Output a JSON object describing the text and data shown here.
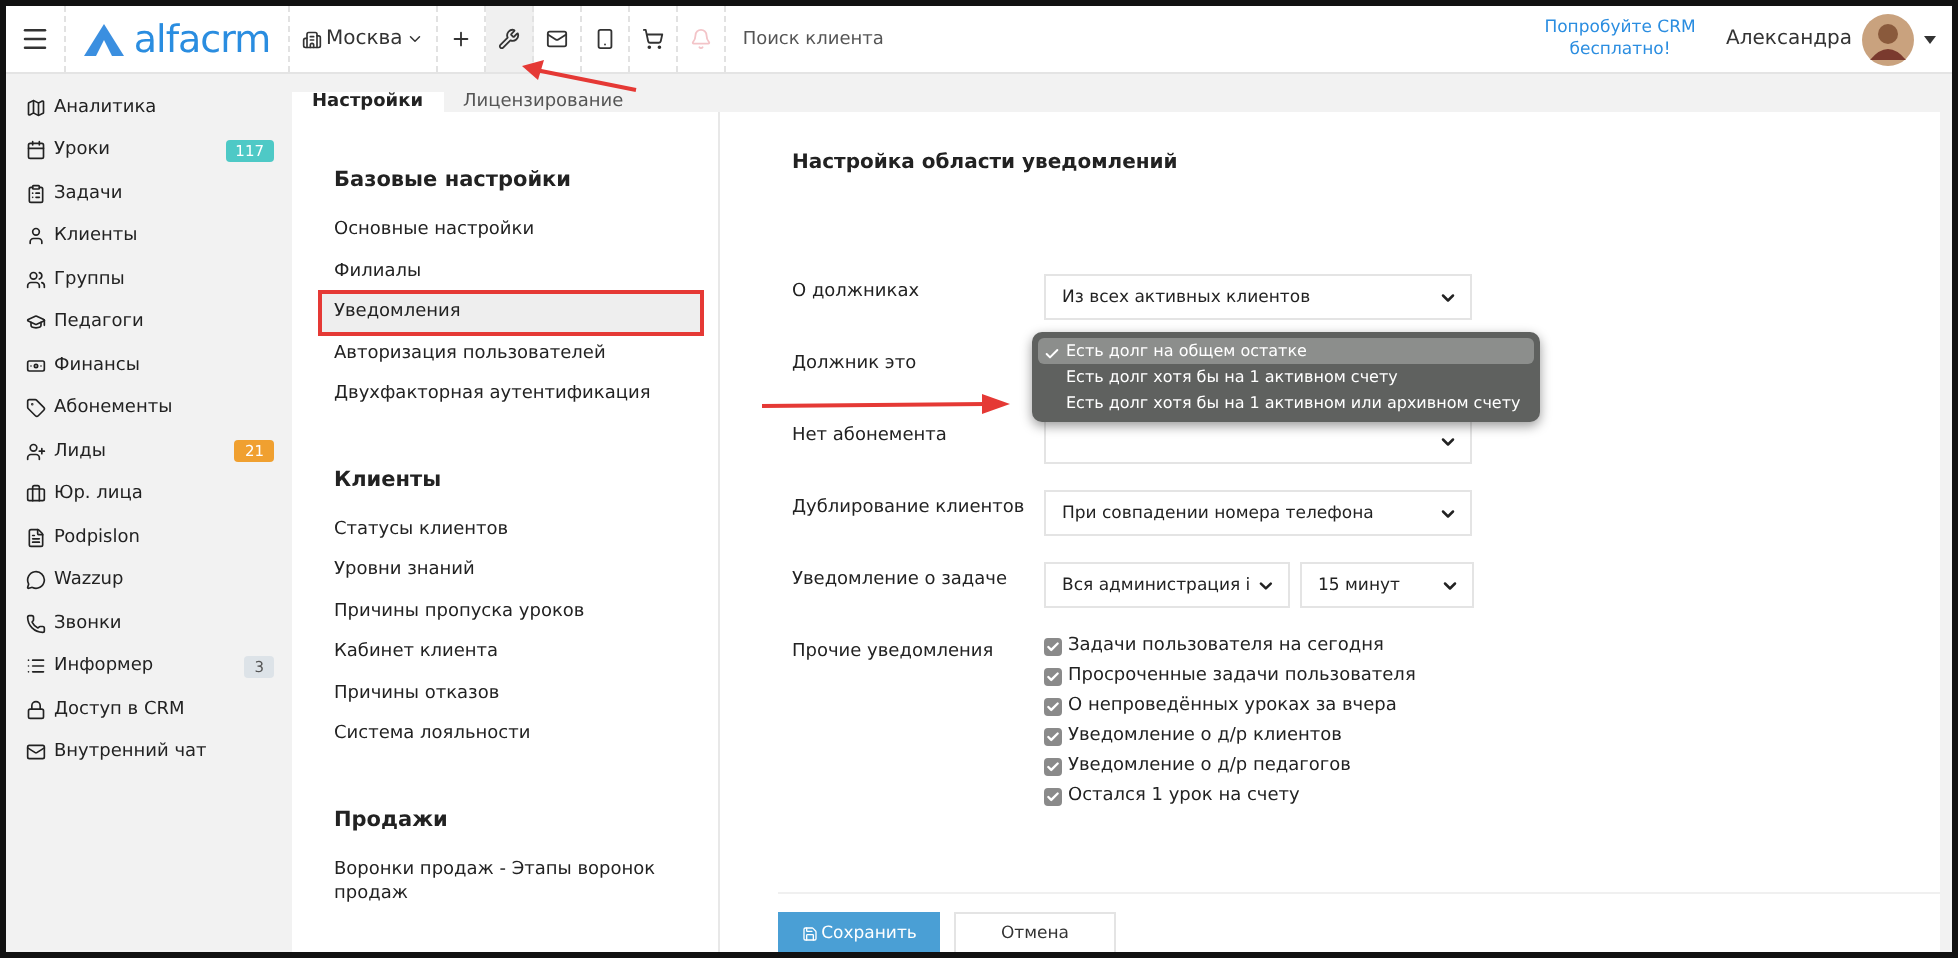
{
  "topbar": {
    "logo": "alfacrm",
    "branch": "Москва",
    "tools": [
      {
        "kind": "plus",
        "selected": false,
        "disabled": false
      },
      {
        "kind": "wrench",
        "selected": true,
        "disabled": false
      },
      {
        "kind": "mail",
        "selected": false,
        "disabled": false
      },
      {
        "kind": "phone",
        "selected": false,
        "disabled": false
      },
      {
        "kind": "cart",
        "selected": false,
        "disabled": false
      },
      {
        "kind": "bell",
        "selected": false,
        "disabled": true
      }
    ],
    "search": {
      "placeholder": "Поиск клиента"
    },
    "promo": "Попробуйте CRM бесплатно!",
    "user": "Александра"
  },
  "sidebar": {
    "items": [
      {
        "label": "Аналитика"
      },
      {
        "label": "Уроки",
        "badge": "117",
        "color": "#4ec9c6"
      },
      {
        "label": "Задачи"
      },
      {
        "label": "Клиенты"
      },
      {
        "label": "Группы"
      },
      {
        "label": "Педагоги"
      },
      {
        "label": "Финансы"
      },
      {
        "label": "Абонементы"
      },
      {
        "label": "Лиды",
        "badge": "21",
        "color": "#f0a030"
      },
      {
        "label": "Юр. лица"
      },
      {
        "label": "Podpislon"
      },
      {
        "label": "Wazzup"
      },
      {
        "label": "Звонки"
      },
      {
        "label": "Информер",
        "badge": "3",
        "color": "#dde3e8"
      },
      {
        "label": "Доступ в CRM"
      },
      {
        "label": "Внутренний чат"
      }
    ]
  },
  "tabs": [
    {
      "label": "Настройки",
      "selected": true
    },
    {
      "label": "Лицензирование",
      "selected": false
    }
  ],
  "settings_nav": [
    {
      "title": "Базовые настройки",
      "items": [
        {
          "label": "Основные настройки",
          "selected": false
        },
        {
          "label": "Филиалы",
          "selected": false
        },
        {
          "label": "Уведомления",
          "selected": true
        },
        {
          "label": "Авторизация пользователей",
          "selected": false
        },
        {
          "label": "Двухфакторная аутентификация",
          "selected": false
        }
      ]
    },
    {
      "title": "Клиенты",
      "items": [
        {
          "label": "Статусы клиентов",
          "selected": false
        },
        {
          "label": "Уровни знаний",
          "selected": false
        },
        {
          "label": "Причины пропуска уроков",
          "selected": false
        },
        {
          "label": "Кабинет клиента",
          "selected": false
        },
        {
          "label": "Причины отказов",
          "selected": false
        },
        {
          "label": "Система лояльности",
          "selected": false
        }
      ]
    },
    {
      "title": "Продажи",
      "items": [
        {
          "label": "Воронки продаж - Этапы воронок продаж",
          "selected": false
        }
      ]
    }
  ],
  "form": {
    "title": "Настройка области уведомлений",
    "rows": [
      {
        "kind": "select",
        "label": "О должниках",
        "values": [
          "Из всех активных клиентов"
        ]
      },
      {
        "kind": "dropdown",
        "label": "Должник это",
        "options": [
          {
            "label": "Есть долг на общем остатке",
            "selected": true
          },
          {
            "label": "Есть долг хотя бы на 1 активном счету",
            "selected": false
          },
          {
            "label": "Есть долг хотя бы на 1 активном или архивном счету",
            "selected": false
          }
        ]
      },
      {
        "kind": "select",
        "label": "Нет абонемента"
      },
      {
        "kind": "select",
        "label": "Дублирование клиентов",
        "values": [
          "При совпадении номера телефона"
        ]
      },
      {
        "kind": "select",
        "label": "Уведомление о задаче",
        "values": [
          "Вся администрация і",
          "15 минут"
        ]
      },
      {
        "kind": "checkboxes",
        "label": "Прочие уведомления",
        "items": [
          {
            "label": "Задачи пользователя на сегодня",
            "checked": true
          },
          {
            "label": "Просроченные задачи пользователя",
            "checked": true
          },
          {
            "label": "О непроведённых уроках за вчера",
            "checked": true
          },
          {
            "label": "Уведомление о д/р клиентов",
            "checked": true
          },
          {
            "label": "Уведомление о д/р педагогов",
            "checked": true
          },
          {
            "label": "Остался 1 урок на счету",
            "checked": true
          }
        ]
      }
    ]
  },
  "buttons": [
    {
      "label": "Сохранить",
      "kind": "primary"
    },
    {
      "label": "Отмена",
      "kind": "secondary"
    }
  ]
}
